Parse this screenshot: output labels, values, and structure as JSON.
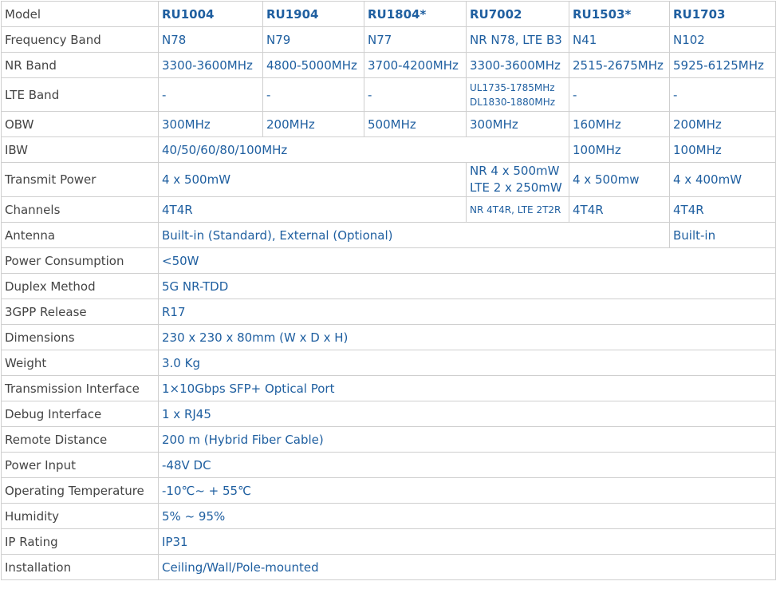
{
  "header": {
    "label": "Model",
    "models": [
      "RU1004",
      "RU1904",
      "RU1804*",
      "RU7002",
      "RU1503*",
      "RU1703"
    ]
  },
  "rows": {
    "frequency_band": {
      "label": "Frequency Band",
      "values": [
        "N78",
        "N79",
        "N77",
        "NR N78, LTE B3",
        "N41",
        "N102"
      ]
    },
    "nr_band": {
      "label": "NR Band",
      "values": [
        "3300-3600MHz",
        "4800-5000MHz",
        "3700-4200MHz",
        "3300-3600MHz",
        "2515-2675MHz",
        "5925-6125MHz"
      ]
    },
    "lte_band": {
      "label": "LTE Band",
      "values": [
        "-",
        "-",
        "-",
        "UL1735-1785MHz",
        "DL1830-1880MHz",
        "-",
        "-"
      ]
    },
    "obw": {
      "label": "OBW",
      "values": [
        "300MHz",
        "200MHz",
        "500MHz",
        "300MHz",
        "160MHz",
        "200MHz"
      ]
    },
    "ibw": {
      "label": "IBW",
      "values": [
        "40/50/60/80/100MHz",
        "100MHz",
        "100MHz"
      ]
    },
    "transmit_power": {
      "label": "Transmit Power",
      "values": [
        "4 x 500mW",
        "NR 4 x 500mW",
        "LTE 2 x 250mW",
        "4 x 500mw",
        "4 x 400mW"
      ]
    },
    "channels": {
      "label": "Channels",
      "values": [
        "4T4R",
        "NR 4T4R, LTE 2T2R",
        "4T4R",
        "4T4R"
      ]
    },
    "antenna": {
      "label": "Antenna",
      "values": [
        "Built-in (Standard), External (Optional)",
        "Built-in"
      ]
    },
    "power_consumption": {
      "label": "Power Consumption",
      "value": "<50W"
    },
    "duplex_method": {
      "label": "Duplex Method",
      "value": "5G NR-TDD"
    },
    "release_3gpp": {
      "label": "3GPP Release",
      "value": "R17"
    },
    "dimensions": {
      "label": "Dimensions",
      "value": "230 x 230 x 80mm (W x D x H)"
    },
    "weight": {
      "label": "Weight",
      "value": "3.0 Kg"
    },
    "transmission_interface": {
      "label": "Transmission Interface",
      "value": "1×10Gbps SFP+ Optical Port"
    },
    "debug_interface": {
      "label": "Debug Interface",
      "value": "1 x RJ45"
    },
    "remote_distance": {
      "label": "Remote Distance",
      "value": "200 m (Hybrid Fiber Cable)"
    },
    "power_input": {
      "label": "Power Input",
      "value": "-48V DC"
    },
    "operating_temperature": {
      "label": "Operating Temperature",
      "value": "-10℃~ + 55℃"
    },
    "humidity": {
      "label": "Humidity",
      "value": "5% ~ 95%"
    },
    "ip_rating": {
      "label": "IP Rating",
      "value": "IP31"
    },
    "installation": {
      "label": "Installation",
      "value": "Ceiling/Wall/Pole-mounted"
    }
  }
}
